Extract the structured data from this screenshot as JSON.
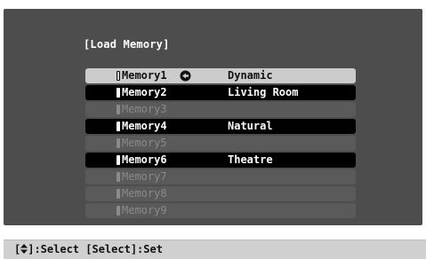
{
  "menu": {
    "title": "[Load Memory]"
  },
  "memories": [
    {
      "name": "Memory1",
      "value": "Dynamic",
      "state": "selected"
    },
    {
      "name": "Memory2",
      "value": "Living Room",
      "state": "filled"
    },
    {
      "name": "Memory3",
      "value": "",
      "state": "empty"
    },
    {
      "name": "Memory4",
      "value": "Natural",
      "state": "filled"
    },
    {
      "name": "Memory5",
      "value": "",
      "state": "empty"
    },
    {
      "name": "Memory6",
      "value": "Theatre",
      "state": "filled"
    },
    {
      "name": "Memory7",
      "value": "",
      "state": "empty"
    },
    {
      "name": "Memory8",
      "value": "",
      "state": "empty"
    },
    {
      "name": "Memory9",
      "value": "",
      "state": "empty"
    }
  ],
  "footer": {
    "bracket_open": "[",
    "select_hint": "]:Select [Select]:Set"
  },
  "icons": {
    "cursor": "cursor-arrow-circle-icon",
    "navigate": "up-down-arrows-icon"
  },
  "colors": {
    "panel": "#4d4d4d",
    "selected_row": "#cccccc",
    "filled_row": "#000000",
    "empty_row": "#5a5a5a",
    "footer": "#d0d0d0"
  }
}
